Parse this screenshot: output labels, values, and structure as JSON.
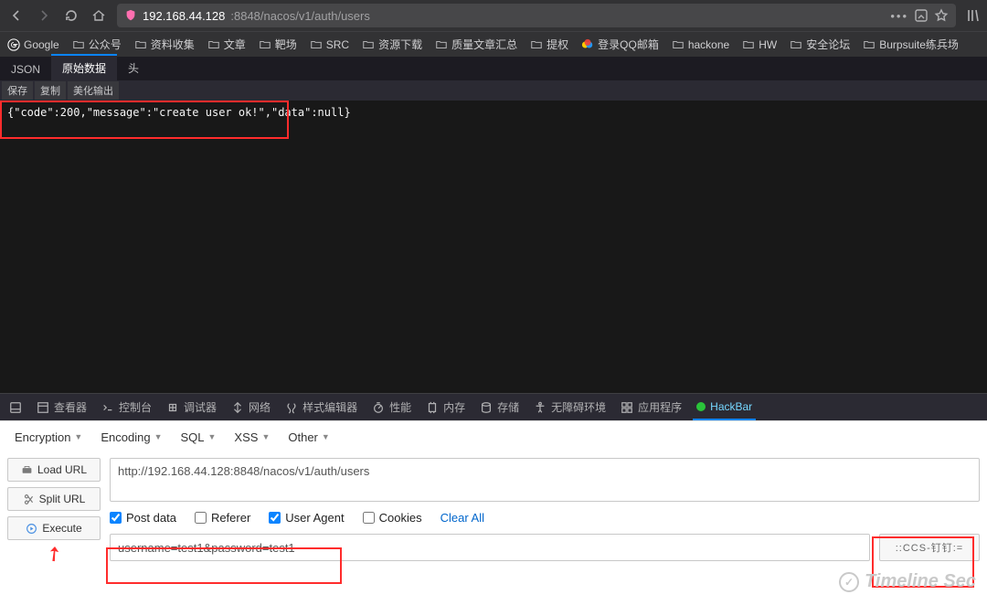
{
  "nav": {
    "url_host": "192.168.44.128",
    "url_port_path": ":8848/nacos/v1/auth/users"
  },
  "bookmarks": [
    {
      "label": "Google",
      "type": "google"
    },
    {
      "label": "公众号",
      "type": "folder"
    },
    {
      "label": "资料收集",
      "type": "folder"
    },
    {
      "label": "文章",
      "type": "folder"
    },
    {
      "label": "靶场",
      "type": "folder"
    },
    {
      "label": "SRC",
      "type": "folder"
    },
    {
      "label": "资源下载",
      "type": "folder"
    },
    {
      "label": "质量文章汇总",
      "type": "folder"
    },
    {
      "label": "提权",
      "type": "folder"
    },
    {
      "label": "登录QQ邮箱",
      "type": "qq"
    },
    {
      "label": "hackone",
      "type": "folder"
    },
    {
      "label": "HW",
      "type": "folder"
    },
    {
      "label": "安全论坛",
      "type": "folder"
    },
    {
      "label": "Burpsuite练兵场",
      "type": "folder"
    }
  ],
  "content_tabs": {
    "json": "JSON",
    "raw": "原始数据",
    "headers": "头"
  },
  "sub_actions": {
    "save": "保存",
    "copy": "复制",
    "beautify": "美化输出"
  },
  "response_text": "{\"code\":200,\"message\":\"create user ok!\",\"data\":null}",
  "devtools": {
    "inspector": "查看器",
    "console": "控制台",
    "debugger": "调试器",
    "network": "网络",
    "style_editor": "样式编辑器",
    "performance": "性能",
    "memory": "内存",
    "storage": "存储",
    "accessibility": "无障碍环境",
    "application": "应用程序",
    "hackbar": "HackBar"
  },
  "hackbar": {
    "menus": {
      "encryption": "Encryption",
      "encoding": "Encoding",
      "sql": "SQL",
      "xss": "XSS",
      "other": "Other"
    },
    "buttons": {
      "load_url": "Load URL",
      "split_url": "Split URL",
      "execute": "Execute"
    },
    "url_value": "http://192.168.44.128:8848/nacos/v1/auth/users",
    "checks": {
      "post_data": "Post data",
      "referer": "Referer",
      "user_agent": "User Agent",
      "cookies": "Cookies",
      "clear_all": "Clear All"
    },
    "post_value": "username=test1&password=test1",
    "add_header_label": "::CCS-钉钉:="
  },
  "watermark": "Timeline Sec"
}
